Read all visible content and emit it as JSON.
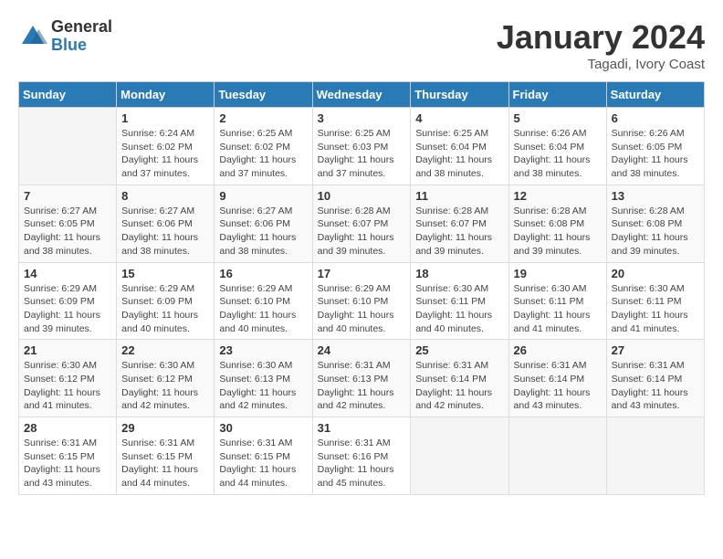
{
  "logo": {
    "general": "General",
    "blue": "Blue"
  },
  "title": "January 2024",
  "subtitle": "Tagadi, Ivory Coast",
  "days_header": [
    "Sunday",
    "Monday",
    "Tuesday",
    "Wednesday",
    "Thursday",
    "Friday",
    "Saturday"
  ],
  "weeks": [
    [
      {
        "day": "",
        "info": ""
      },
      {
        "day": "1",
        "info": "Sunrise: 6:24 AM\nSunset: 6:02 PM\nDaylight: 11 hours and 37 minutes."
      },
      {
        "day": "2",
        "info": "Sunrise: 6:25 AM\nSunset: 6:02 PM\nDaylight: 11 hours and 37 minutes."
      },
      {
        "day": "3",
        "info": "Sunrise: 6:25 AM\nSunset: 6:03 PM\nDaylight: 11 hours and 37 minutes."
      },
      {
        "day": "4",
        "info": "Sunrise: 6:25 AM\nSunset: 6:04 PM\nDaylight: 11 hours and 38 minutes."
      },
      {
        "day": "5",
        "info": "Sunrise: 6:26 AM\nSunset: 6:04 PM\nDaylight: 11 hours and 38 minutes."
      },
      {
        "day": "6",
        "info": "Sunrise: 6:26 AM\nSunset: 6:05 PM\nDaylight: 11 hours and 38 minutes."
      }
    ],
    [
      {
        "day": "7",
        "info": "Sunrise: 6:27 AM\nSunset: 6:05 PM\nDaylight: 11 hours and 38 minutes."
      },
      {
        "day": "8",
        "info": "Sunrise: 6:27 AM\nSunset: 6:06 PM\nDaylight: 11 hours and 38 minutes."
      },
      {
        "day": "9",
        "info": "Sunrise: 6:27 AM\nSunset: 6:06 PM\nDaylight: 11 hours and 38 minutes."
      },
      {
        "day": "10",
        "info": "Sunrise: 6:28 AM\nSunset: 6:07 PM\nDaylight: 11 hours and 39 minutes."
      },
      {
        "day": "11",
        "info": "Sunrise: 6:28 AM\nSunset: 6:07 PM\nDaylight: 11 hours and 39 minutes."
      },
      {
        "day": "12",
        "info": "Sunrise: 6:28 AM\nSunset: 6:08 PM\nDaylight: 11 hours and 39 minutes."
      },
      {
        "day": "13",
        "info": "Sunrise: 6:28 AM\nSunset: 6:08 PM\nDaylight: 11 hours and 39 minutes."
      }
    ],
    [
      {
        "day": "14",
        "info": "Sunrise: 6:29 AM\nSunset: 6:09 PM\nDaylight: 11 hours and 39 minutes."
      },
      {
        "day": "15",
        "info": "Sunrise: 6:29 AM\nSunset: 6:09 PM\nDaylight: 11 hours and 40 minutes."
      },
      {
        "day": "16",
        "info": "Sunrise: 6:29 AM\nSunset: 6:10 PM\nDaylight: 11 hours and 40 minutes."
      },
      {
        "day": "17",
        "info": "Sunrise: 6:29 AM\nSunset: 6:10 PM\nDaylight: 11 hours and 40 minutes."
      },
      {
        "day": "18",
        "info": "Sunrise: 6:30 AM\nSunset: 6:11 PM\nDaylight: 11 hours and 40 minutes."
      },
      {
        "day": "19",
        "info": "Sunrise: 6:30 AM\nSunset: 6:11 PM\nDaylight: 11 hours and 41 minutes."
      },
      {
        "day": "20",
        "info": "Sunrise: 6:30 AM\nSunset: 6:11 PM\nDaylight: 11 hours and 41 minutes."
      }
    ],
    [
      {
        "day": "21",
        "info": "Sunrise: 6:30 AM\nSunset: 6:12 PM\nDaylight: 11 hours and 41 minutes."
      },
      {
        "day": "22",
        "info": "Sunrise: 6:30 AM\nSunset: 6:12 PM\nDaylight: 11 hours and 42 minutes."
      },
      {
        "day": "23",
        "info": "Sunrise: 6:30 AM\nSunset: 6:13 PM\nDaylight: 11 hours and 42 minutes."
      },
      {
        "day": "24",
        "info": "Sunrise: 6:31 AM\nSunset: 6:13 PM\nDaylight: 11 hours and 42 minutes."
      },
      {
        "day": "25",
        "info": "Sunrise: 6:31 AM\nSunset: 6:14 PM\nDaylight: 11 hours and 42 minutes."
      },
      {
        "day": "26",
        "info": "Sunrise: 6:31 AM\nSunset: 6:14 PM\nDaylight: 11 hours and 43 minutes."
      },
      {
        "day": "27",
        "info": "Sunrise: 6:31 AM\nSunset: 6:14 PM\nDaylight: 11 hours and 43 minutes."
      }
    ],
    [
      {
        "day": "28",
        "info": "Sunrise: 6:31 AM\nSunset: 6:15 PM\nDaylight: 11 hours and 43 minutes."
      },
      {
        "day": "29",
        "info": "Sunrise: 6:31 AM\nSunset: 6:15 PM\nDaylight: 11 hours and 44 minutes."
      },
      {
        "day": "30",
        "info": "Sunrise: 6:31 AM\nSunset: 6:15 PM\nDaylight: 11 hours and 44 minutes."
      },
      {
        "day": "31",
        "info": "Sunrise: 6:31 AM\nSunset: 6:16 PM\nDaylight: 11 hours and 45 minutes."
      },
      {
        "day": "",
        "info": ""
      },
      {
        "day": "",
        "info": ""
      },
      {
        "day": "",
        "info": ""
      }
    ]
  ]
}
